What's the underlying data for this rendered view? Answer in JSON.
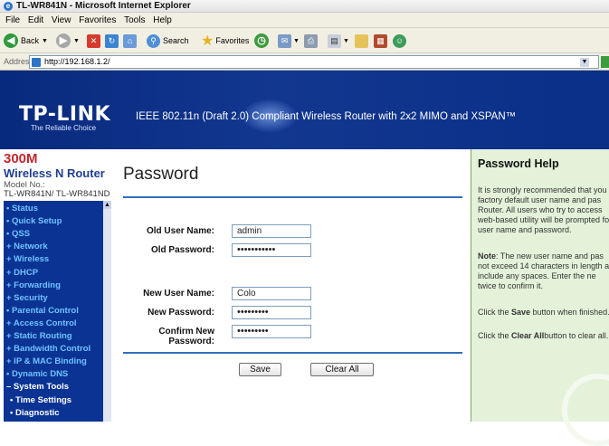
{
  "window": {
    "title": "TL-WR841N - Microsoft Internet Explorer"
  },
  "menu": [
    "File",
    "Edit",
    "View",
    "Favorites",
    "Tools",
    "Help"
  ],
  "toolbar": {
    "back_label": "Back",
    "search_label": "Search",
    "favorites_label": "Favorites"
  },
  "address": {
    "label": "Address",
    "url": "http://192.168.1.2/"
  },
  "banner": {
    "logo": "TP-LINK",
    "logo_sub": "The Reliable Choice",
    "tagline": "IEEE 802.11n (Draft 2.0) Compliant Wireless Router with 2x2 MIMO and XSPAN™"
  },
  "sidebar": {
    "product_line1": "300M",
    "product_line2": "Wireless N Router",
    "model_label": "Model No.:",
    "model_value": "TL-WR841N/ TL-WR841ND",
    "nav": [
      {
        "label": "• Status",
        "style": "blue"
      },
      {
        "label": "• Quick Setup",
        "style": "blue"
      },
      {
        "label": "• QSS",
        "style": "blue"
      },
      {
        "label": "+ Network",
        "style": "blue"
      },
      {
        "label": "+ Wireless",
        "style": "blue"
      },
      {
        "label": "+ DHCP",
        "style": "blue"
      },
      {
        "label": "+ Forwarding",
        "style": "blue"
      },
      {
        "label": "+ Security",
        "style": "blue"
      },
      {
        "label": "• Parental Control",
        "style": "blue"
      },
      {
        "label": "+ Access Control",
        "style": "blue"
      },
      {
        "label": "+ Static Routing",
        "style": "blue"
      },
      {
        "label": "+ Bandwidth Control",
        "style": "blue"
      },
      {
        "label": "+ IP & MAC Binding",
        "style": "blue"
      },
      {
        "label": "• Dynamic DNS",
        "style": "blue"
      },
      {
        "label": "– System Tools",
        "style": "white"
      },
      {
        "label": "• Time Settings",
        "style": "sub"
      },
      {
        "label": "• Diagnostic",
        "style": "sub"
      }
    ]
  },
  "form": {
    "title": "Password",
    "old_user_label": "Old User Name:",
    "old_user_value": "admin",
    "old_password_label": "Old Password:",
    "old_password_value": "•••••••••••",
    "new_user_label": "New User Name:",
    "new_user_value": "Colo",
    "new_password_label": "New Password:",
    "new_password_value": "•••••••••",
    "confirm_password_label": "Confirm New Password:",
    "confirm_password_value": "•••••••••",
    "save_label": "Save",
    "clear_label": "Clear All"
  },
  "help": {
    "title": "Password Help",
    "lines1": [
      "It is strongly recommended that you",
      "factory default user name and pas",
      "Router. All users who try to access",
      "web-based utility will be prompted fo",
      "user name and password."
    ],
    "note_bold": "Note",
    "note_rest": ": The new user name and pas",
    "lines2": [
      "not exceed 14 characters in length a",
      "include any spaces. Enter the ne",
      "twice to confirm it."
    ],
    "save_pre": "Click the ",
    "save_bold": "Save",
    "save_post": " button when finished.",
    "clear_pre": "Click the ",
    "clear_bold": "Clear All",
    "clear_post": "button to clear all."
  }
}
